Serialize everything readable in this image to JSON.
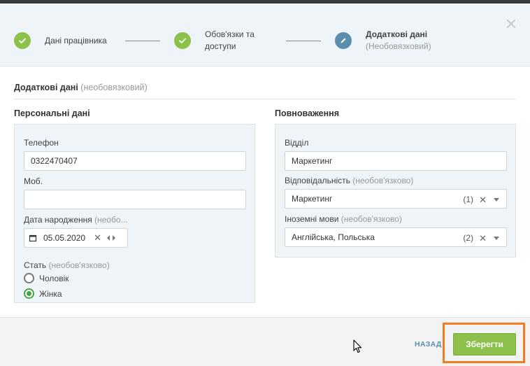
{
  "stepper": {
    "steps": [
      {
        "label": "Дані працівника",
        "sub": "",
        "state": "done"
      },
      {
        "label": "Обов'язки та",
        "label2": "доступи",
        "state": "done"
      },
      {
        "label": "Додаткові дані",
        "sub": "(Необовязковий)",
        "state": "active"
      }
    ]
  },
  "form": {
    "title": "Додаткові дані",
    "title_opt": "(необовязковий)",
    "personal": {
      "title": "Персональні дані",
      "phone_label": "Телефон",
      "phone_value": "0322470407",
      "mobile_label": "Моб.",
      "mobile_value": "",
      "birth_label": "Дата народження",
      "birth_opt": "(необо...",
      "birth_value": "05.05.2020",
      "gender_label": "Стать",
      "gender_opt": "(необов'язково)",
      "gender_options": [
        "Чоловік",
        "Жінка"
      ],
      "gender_selected": "Жінка"
    },
    "authority": {
      "title": "Повноваження",
      "department_label": "Відділ",
      "department_value": "Маркетинг",
      "responsibility_label": "Відповідальність",
      "responsibility_opt": "(необов'язково)",
      "responsibility_value": "Маркетинг",
      "responsibility_count": "(1)",
      "languages_label": "Іноземні мови",
      "languages_opt": "(необов'язково)",
      "languages_value": "Англійська, Польська",
      "languages_count": "(2)"
    }
  },
  "footer": {
    "back_label": "НАЗАД",
    "save_label": "Зберегти"
  },
  "colors": {
    "done": "#8dc14b",
    "active": "#5b8ead",
    "highlight": "#f47b20"
  }
}
